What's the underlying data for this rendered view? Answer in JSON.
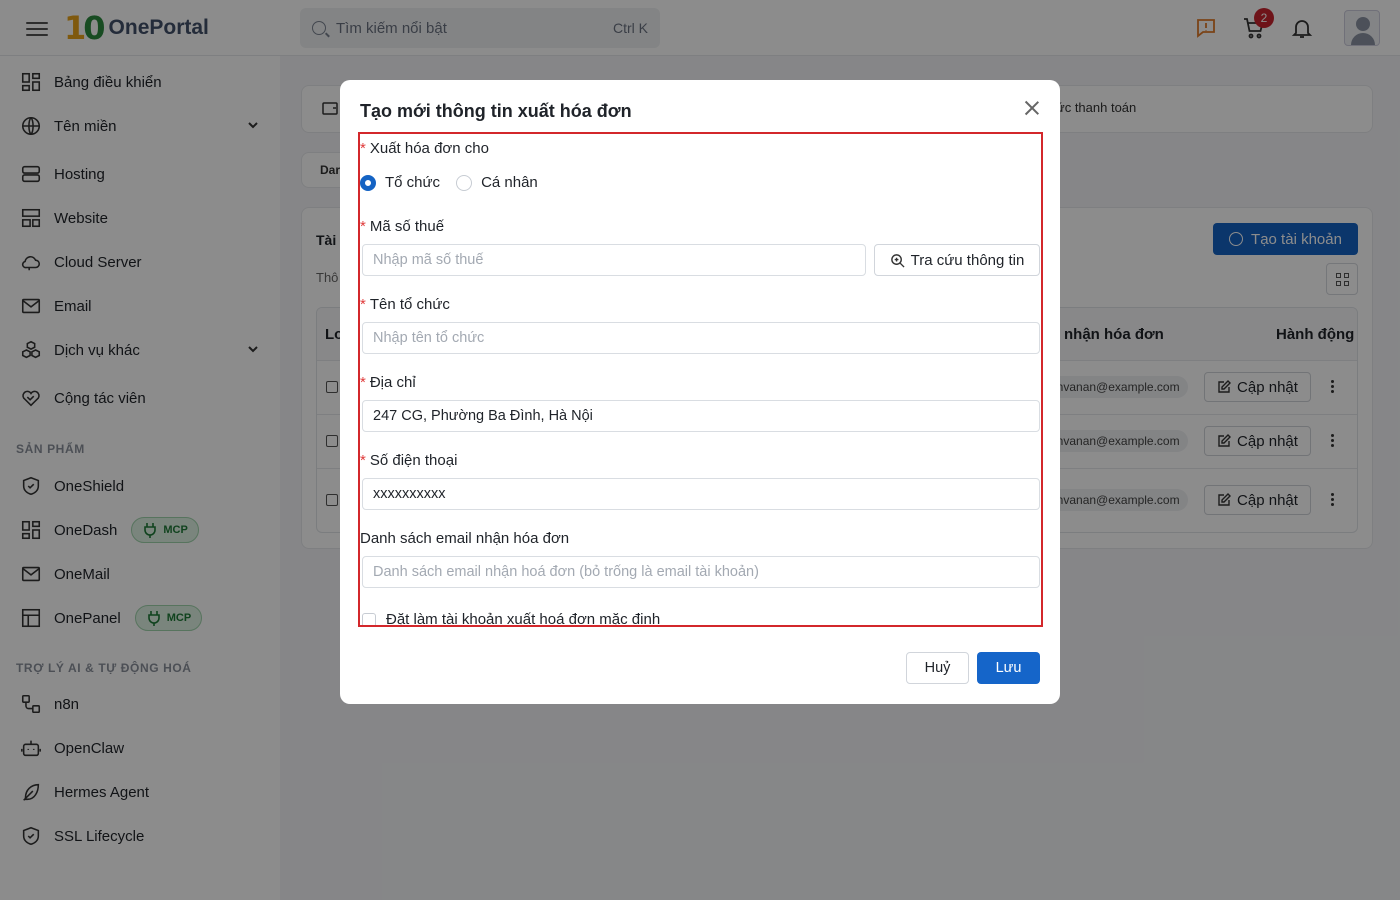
{
  "brand": {
    "mark_a": "1",
    "mark_b": "0",
    "name": "OnePortal"
  },
  "search": {
    "placeholder": "Tìm kiếm nổi bật",
    "shortcut": "Ctrl K"
  },
  "header": {
    "cart_count": "2"
  },
  "sidebar": {
    "items": [
      {
        "label": "Bảng điều khiển",
        "icon": "dashboard-icon"
      },
      {
        "label": "Tên miền",
        "icon": "globe-icon",
        "expandable": true
      },
      {
        "label": "Hosting",
        "icon": "server-icon"
      },
      {
        "label": "Website",
        "icon": "layout-icon"
      },
      {
        "label": "Cloud Server",
        "icon": "cloud-icon"
      },
      {
        "label": "Email",
        "icon": "mail-icon"
      },
      {
        "label": "Dịch vụ khác",
        "icon": "boxes-icon",
        "expandable": true
      },
      {
        "label": "Cộng tác viên",
        "icon": "handshake-icon"
      }
    ],
    "section_products": "SẢN PHẨM",
    "products": [
      {
        "label": "OneShield",
        "icon": "shield-icon"
      },
      {
        "label": "OneDash",
        "icon": "dashboard-icon",
        "badge": "MCP"
      },
      {
        "label": "OneMail",
        "icon": "mail-icon"
      },
      {
        "label": "OnePanel",
        "icon": "panel-icon",
        "badge": "MCP"
      }
    ],
    "section_ai": "TRỢ LÝ AI & TỰ ĐỘNG HOÁ",
    "ai": [
      {
        "label": "n8n",
        "icon": "workflow-icon"
      },
      {
        "label": "OpenClaw",
        "icon": "bot-icon"
      },
      {
        "label": "Hermes Agent",
        "icon": "feather-icon"
      },
      {
        "label": "SSL Lifecycle",
        "icon": "shield-check-icon"
      }
    ]
  },
  "background": {
    "payment_method_text": "ức thanh toán",
    "tab_fragment": "Dar",
    "title_fragment": "Tài",
    "subtitle_fragment": "Thô",
    "create_account": "Tạo tài khoản",
    "table": {
      "col_first": "Lo",
      "col_email": "nhận hóa đơn",
      "col_actions": "Hành động",
      "rows": [
        {
          "email": "envanan@example.com",
          "action": "Cập nhật"
        },
        {
          "email": "envanan@example.com",
          "action": "Cập nhật"
        },
        {
          "email": "envanan@example.com",
          "action": "Cập nhật"
        }
      ]
    }
  },
  "modal": {
    "title": "Tạo mới thông tin xuất hóa đơn",
    "invoice_for_label": "Xuất hóa đơn cho",
    "invoice_for_options": [
      {
        "label": "Tổ chức",
        "checked": true
      },
      {
        "label": "Cá nhân",
        "checked": false
      }
    ],
    "tax_code_label": "Mã số thuế",
    "tax_code_placeholder": "Nhập mã số thuế",
    "lookup_button": "Tra cứu thông tin",
    "org_name_label": "Tên tổ chức",
    "org_name_placeholder": "Nhập tên tổ chức",
    "address_label": "Địa chỉ",
    "address_value": "247 CG, Phường Ba Đình, Hà Nội",
    "phone_label": "Số điện thoại",
    "phone_value": "xxxxxxxxxx",
    "email_list_label": "Danh sách email nhận hóa đơn",
    "email_list_placeholder": "Danh sách email nhận hoá đơn (bỏ trống là email tài khoản)",
    "default_checkbox_label": "Đặt làm tài khoản xuất hoá đơn mặc định",
    "cancel_button": "Huỷ",
    "save_button": "Lưu"
  },
  "colors": {
    "primary": "#1565c9",
    "required": "#e03b3b",
    "highlight_border": "#d3272b",
    "mcp_green": "#1e7a37"
  }
}
